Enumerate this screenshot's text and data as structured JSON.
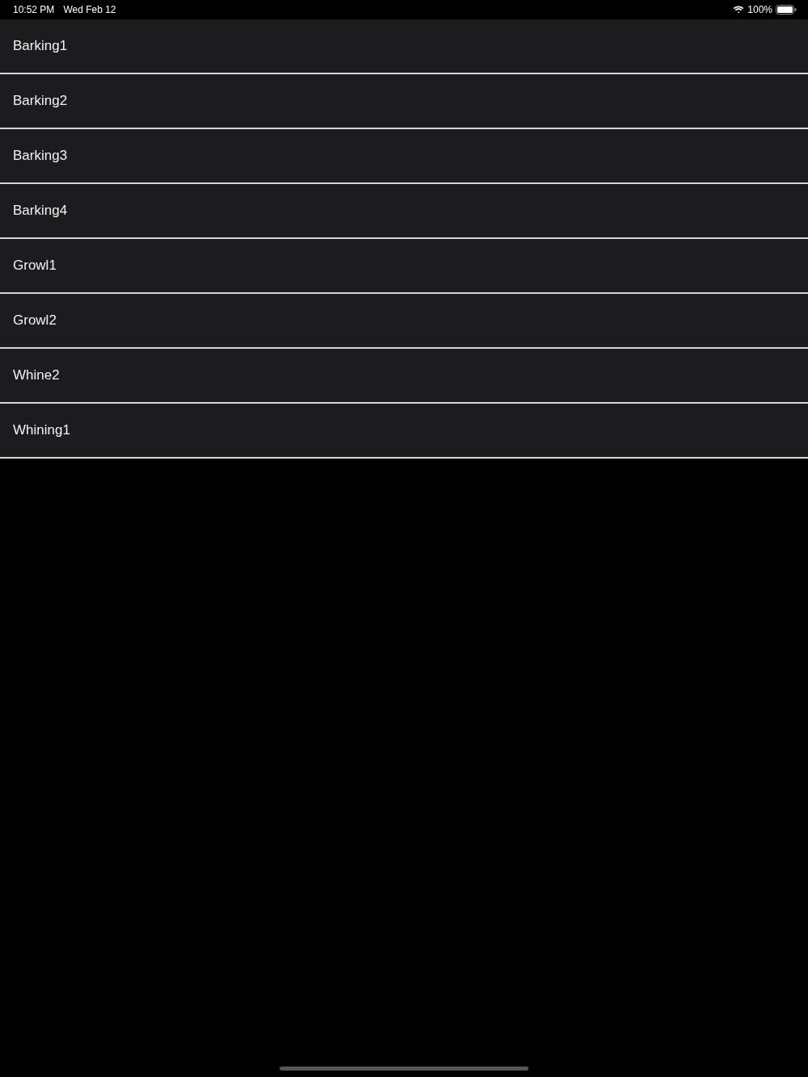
{
  "status_bar": {
    "time": "10:52 PM",
    "date": "Wed Feb 12",
    "battery": "100%"
  },
  "list": {
    "items": [
      {
        "label": "Barking1"
      },
      {
        "label": "Barking2"
      },
      {
        "label": "Barking3"
      },
      {
        "label": "Barking4"
      },
      {
        "label": "Growl1"
      },
      {
        "label": "Growl2"
      },
      {
        "label": "Whine2"
      },
      {
        "label": "Whining1"
      }
    ]
  }
}
